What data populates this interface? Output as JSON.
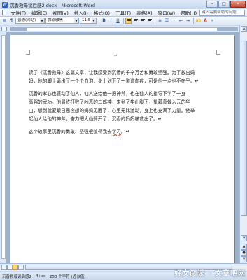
{
  "window": {
    "title": "沉香救母读后感2.docx - Microsoft Word",
    "minimize_glyph": "–",
    "maximize_glyph": "□",
    "close_glyph": "✕"
  },
  "menu": {
    "items": [
      "文件(F)",
      "编辑(E)",
      "视图(V)",
      "插入(I)",
      "格式(O)",
      "工具(T)",
      "表格(A)",
      "窗口(W)",
      "帮助(H)"
    ],
    "help_placeholder": "键入需要帮助的问题"
  },
  "toolbar": {
    "style": "普通(网站)",
    "font": "微软雅黑",
    "size": "11.5",
    "bold": "B",
    "italic": "I",
    "underline": "U",
    "font_color_glyph": "A",
    "highlight_glyph": "ab"
  },
  "document": {
    "top_mark": "↵",
    "paragraphs": [
      {
        "lines": [
          "读了《沉香救母》这篇文章，让我感受到沉香的千辛万苦和勇敢坚强。为了救出妈",
          "妈，他的脚上磨出了一个个血泡，身上划下了一道道血痕，可是他一点也不在乎。↵"
        ]
      },
      {
        "lines": [
          "    沉香的孝心也感动了仙人，仙人送给他一把神斧，也在仙人的指导下学了一身",
          "高强的武功。他最终打败了凶恶的二郎神，来到了华山脚下，望着高耸入云的华",
          "山，想到就要跟日思夜想的妈妈见面了，心里无比激动，身上也充满了力量。他举",
          "起仙人给他的神斧，奋力把大山劈开了，沉香的妈妈被救出了。↵"
        ]
      },
      {
        "lines_prefix": "    这个故事里沉香的勇敢、坚强很值得我去",
        "lines_underlined": "学习",
        "lines_suffix": "。↵"
      }
    ]
  },
  "status": {
    "page": "沉香救母读后感2",
    "size": "4+cs",
    "words": "250 个字符 (近似值)"
  },
  "watermark": "好文阅读 · 文章吧网"
}
